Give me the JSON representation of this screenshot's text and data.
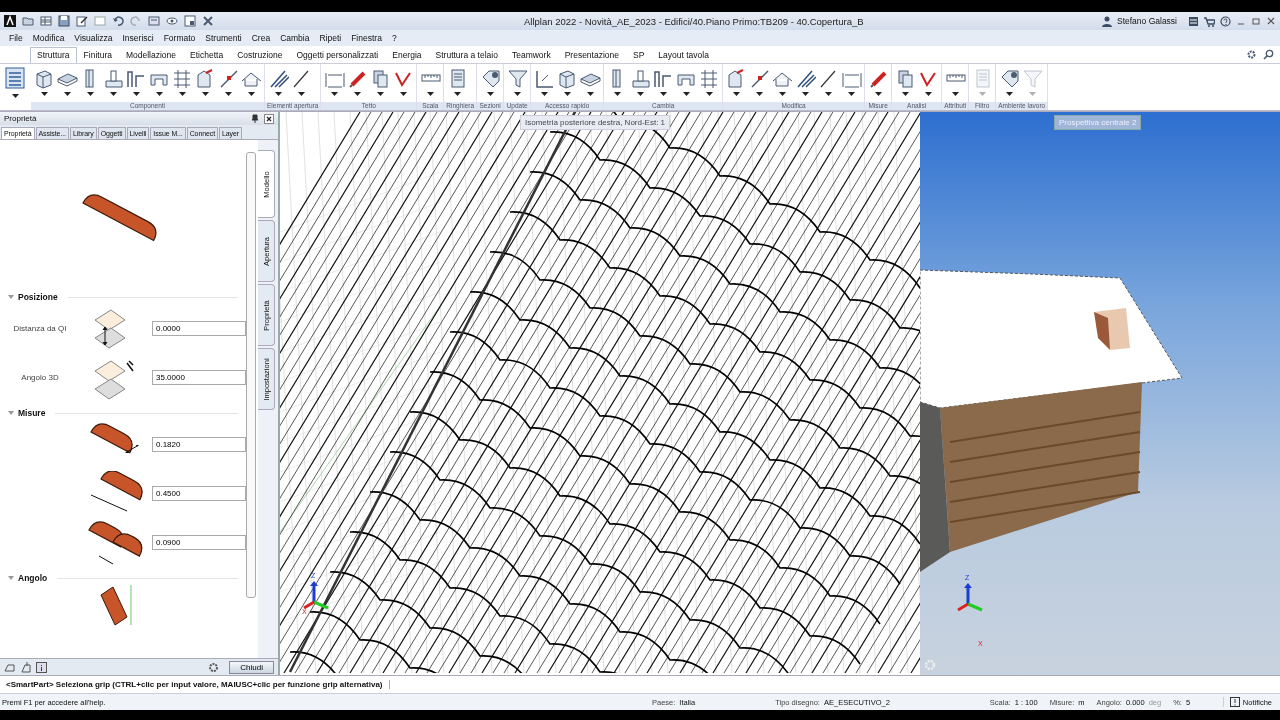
{
  "window": {
    "title": "Allplan 2022 - Novità_AE_2023 - Edifici/40.Piano Primo:TB209 - 40.Copertura_B",
    "user": "Stefano Galassi"
  },
  "menu": [
    "File",
    "Modifica",
    "Visualizza",
    "Inserisci",
    "Formato",
    "Strumenti",
    "Crea",
    "Cambia",
    "Ripeti",
    "Finestra",
    "?"
  ],
  "ribbon_tabs": [
    {
      "label": "Struttura",
      "selected": true
    },
    {
      "label": "Finitura",
      "selected": false
    },
    {
      "label": "Modellazione",
      "selected": false
    },
    {
      "label": "Etichetta",
      "selected": false
    },
    {
      "label": "Costruzione",
      "selected": false
    },
    {
      "label": "Oggetti personalizzati",
      "selected": false
    },
    {
      "label": "Energia",
      "selected": false
    },
    {
      "label": "Struttura a telaio",
      "selected": false
    },
    {
      "label": "Teamwork",
      "selected": false
    },
    {
      "label": "Presentazione",
      "selected": false
    },
    {
      "label": "SP",
      "selected": false
    },
    {
      "label": "Layout tavola",
      "selected": false
    }
  ],
  "ribbon_groups": [
    {
      "label": "Componenti",
      "tools": [
        {
          "disabled": false
        },
        {
          "disabled": false
        },
        {
          "disabled": false
        },
        {
          "disabled": false
        },
        {
          "disabled": false
        },
        {
          "disabled": false
        },
        {
          "disabled": false
        },
        {
          "disabled": false
        },
        {
          "disabled": false
        },
        {
          "disabled": false
        }
      ]
    },
    {
      "label": "Elementi apertura",
      "tools": [
        {
          "disabled": false
        },
        {
          "disabled": false
        }
      ]
    },
    {
      "label": "Tetto",
      "tools": [
        {
          "disabled": false
        },
        {
          "disabled": false
        },
        {
          "disabled": false
        },
        {
          "disabled": false
        }
      ]
    },
    {
      "label": "Scala",
      "tools": [
        {
          "disabled": false
        }
      ]
    },
    {
      "label": "Ringhiera",
      "tools": [
        {
          "disabled": false
        }
      ]
    },
    {
      "label": "Sezioni",
      "tools": [
        {
          "disabled": false
        }
      ]
    },
    {
      "label": "Update",
      "tools": [
        {
          "disabled": false
        }
      ]
    },
    {
      "label": "Accesso rapido",
      "tools": [
        {
          "disabled": false
        },
        {
          "disabled": false
        },
        {
          "disabled": false
        }
      ]
    },
    {
      "label": "Cambia",
      "tools": [
        {
          "disabled": false
        },
        {
          "disabled": false
        },
        {
          "disabled": false
        },
        {
          "disabled": false
        },
        {
          "disabled": false
        }
      ]
    },
    {
      "label": "Modifica",
      "tools": [
        {
          "disabled": false
        },
        {
          "disabled": false
        },
        {
          "disabled": false
        },
        {
          "disabled": false
        },
        {
          "disabled": false
        },
        {
          "disabled": false
        }
      ]
    },
    {
      "label": "Misure",
      "tools": [
        {
          "disabled": false
        }
      ]
    },
    {
      "label": "Analisi",
      "tools": [
        {
          "disabled": false
        },
        {
          "disabled": false
        }
      ]
    },
    {
      "label": "Attributi",
      "tools": [
        {
          "disabled": false
        }
      ]
    },
    {
      "label": "Filtro",
      "tools": [
        {
          "disabled": true
        }
      ]
    },
    {
      "label": "Ambiente lavoro",
      "tools": [
        {
          "disabled": false
        },
        {
          "disabled": true
        }
      ]
    }
  ],
  "palette": {
    "title": "Proprietà",
    "tabs": [
      {
        "label": "Proprietà",
        "selected": true
      },
      {
        "label": "Assiste...",
        "selected": false
      },
      {
        "label": "Library",
        "selected": false
      },
      {
        "label": "Oggetti",
        "selected": false
      },
      {
        "label": "Livelli",
        "selected": false
      },
      {
        "label": "Issue M...",
        "selected": false
      },
      {
        "label": "Connect",
        "selected": false
      },
      {
        "label": "Layer",
        "selected": false
      }
    ],
    "side_tabs": [
      {
        "label": "Modello",
        "selected": true
      },
      {
        "label": "Apertura",
        "selected": false
      },
      {
        "label": "Proprietà",
        "selected": false
      },
      {
        "label": "Impostazioni",
        "selected": false
      }
    ],
    "sections": [
      {
        "title": "Posizione",
        "rows": [
          {
            "kind": "offset",
            "label": "Distanza da QI",
            "value": "0.0000"
          },
          {
            "kind": "tilt",
            "label": "Angolo 3D",
            "value": "35.0000"
          }
        ]
      },
      {
        "title": "Misure",
        "rows": [
          {
            "kind": "width",
            "value": "0.1820"
          },
          {
            "kind": "length",
            "value": "0.4500"
          },
          {
            "kind": "overlap",
            "value": "0.0900"
          }
        ]
      },
      {
        "title": "Angolo",
        "rows": [
          {
            "kind": "angle"
          }
        ]
      }
    ],
    "close_button": "Chiudi"
  },
  "viewports": [
    {
      "kind": "wireframe",
      "label": "Isometria posteriore destra, Nord-Est: 1",
      "axes": [
        "Z",
        "X"
      ]
    },
    {
      "kind": "render",
      "label": "Prospettiva centrale 2",
      "axes": [
        "Z",
        "X"
      ]
    }
  ],
  "command_line": "<SmartPart> Seleziona grip (CTRL+clic per input valore, MAIUSC+clic per funzione grip alternativa)",
  "status_bar": {
    "help": "Premi F1 per accedere all'help.",
    "fields": [
      {
        "label": "Paese:",
        "value": "Italia"
      },
      {
        "label": "Tipo disegno:",
        "value": "AE_ESECUTIVO_2"
      },
      {
        "label": "Scala:",
        "value": "1 : 100"
      },
      {
        "label": "Misure:",
        "value": "m"
      },
      {
        "label": "Angolo:",
        "value": "0.000",
        "unit": "deg"
      },
      {
        "label": "%:",
        "value": "5"
      }
    ],
    "notifications": "Notifiche"
  }
}
